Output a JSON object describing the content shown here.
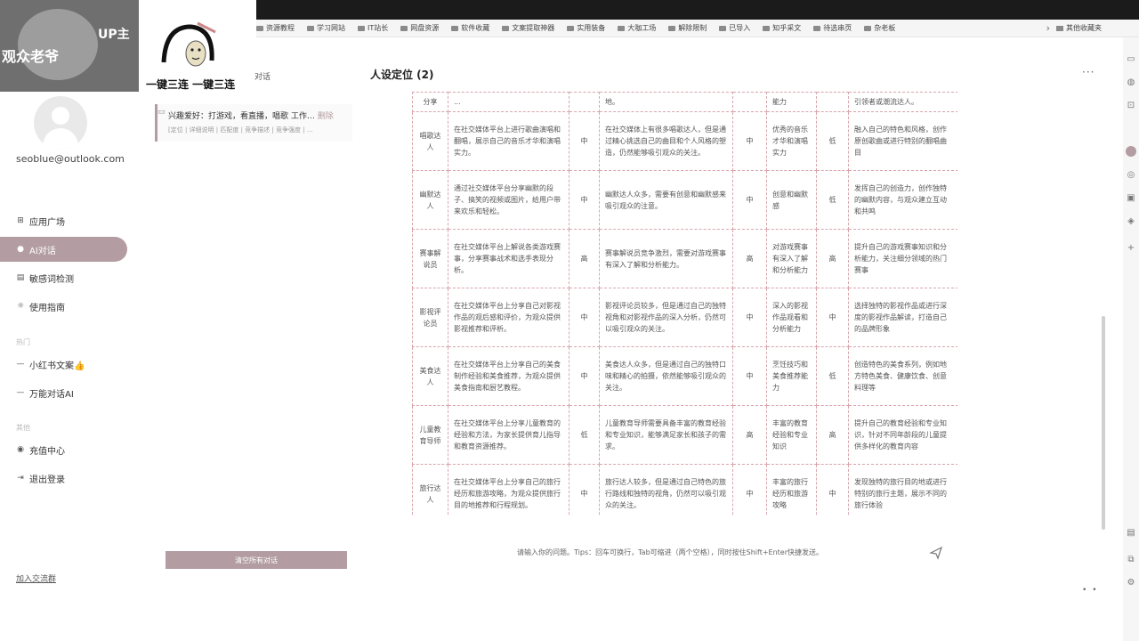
{
  "browser": {
    "bookmarks": [
      "资源教程",
      "学习网站",
      "IT站长",
      "网盘资源",
      "软件收藏",
      "文案提取神器",
      "实用装备",
      "大咖工场",
      "解除限制",
      "已导入",
      "知乎采文",
      "待选串页",
      "杂老板"
    ],
    "other_bookmarks": "其他收藏夹"
  },
  "overlay": {
    "channel_text": "观众老爷",
    "up_text": "UP主",
    "meme_caption": "一键三连 一键三连"
  },
  "sidebar": {
    "email": "seoblue@outlook.com",
    "nav": [
      {
        "label": "应用广场",
        "icon": "grid-icon"
      },
      {
        "label": "AI对话",
        "icon": "chat-icon"
      },
      {
        "label": "敏感词检测",
        "icon": "document-icon"
      },
      {
        "label": "使用指南",
        "icon": "sun-icon"
      }
    ],
    "section1": "热门",
    "apps": [
      {
        "label": "小红书文案👍",
        "icon": "dash-icon"
      },
      {
        "label": "万能对话AI",
        "icon": "dash-icon"
      }
    ],
    "section2": "其他",
    "account": [
      {
        "label": "充值中心",
        "icon": "wallet-icon"
      },
      {
        "label": "退出登录",
        "icon": "logout-icon"
      }
    ],
    "join_link": "加入交流群"
  },
  "history": {
    "header": "对话",
    "item_title": "兴趣爱好：打游戏，看直播，唱歌 工作…",
    "item_badge": "删除",
    "item_tags": "[定位 | 详细说明 | 匹配度 | 竞争描述 | 竞争强度 | …",
    "clear_button": "清空所有对话"
  },
  "main": {
    "title": "人设定位 (2)",
    "more": "···",
    "partial_row": {
      "c1": "分享",
      "c2": "...",
      "c3": "",
      "c4": "地。",
      "c5": "",
      "c6": "能力",
      "c7": "",
      "c8": "引领者或潮流达人。"
    },
    "rows": [
      {
        "c1": "唱歌达人",
        "c2": "在社交媒体平台上进行歌曲演唱和翻唱，展示自己的音乐才华和演唱实力。",
        "c3": "中",
        "c4": "在社交媒体上有很多唱歌达人，但是通过精心挑选自己的曲目和个人风格的塑造，仍然能够吸引观众的关注。",
        "c5": "中",
        "c6": "优秀的音乐才华和演唱实力",
        "c7": "低",
        "c8": "融入自己的特色和风格，创作原创歌曲或进行特别的翻唱曲目"
      },
      {
        "c1": "幽默达人",
        "c2": "通过社交媒体平台分享幽默的段子、搞笑的视频或图片，给用户带来欢乐和轻松。",
        "c3": "中",
        "c4": "幽默达人众多，需要有创意和幽默感来吸引观众的注意。",
        "c5": "中",
        "c6": "创意和幽默感",
        "c7": "低",
        "c8": "发挥自己的创造力，创作独特的幽默内容，与观众建立互动和共鸣"
      },
      {
        "c1": "赛事解说员",
        "c2": "在社交媒体平台上解说各类游戏赛事，分享赛事战术和选手表现分析。",
        "c3": "高",
        "c4": "赛事解说员竞争激烈，需要对游戏赛事有深入了解和分析能力。",
        "c5": "高",
        "c6": "对游戏赛事有深入了解和分析能力",
        "c7": "高",
        "c8": "提升自己的游戏赛事知识和分析能力，关注细分领域的热门赛事"
      },
      {
        "c1": "影视评论员",
        "c2": "在社交媒体平台上分享自己对影视作品的观后感和评价，为观众提供影视推荐和评析。",
        "c3": "中",
        "c4": "影视评论员较多，但是通过自己的独特视角和对影视作品的深入分析，仍然可以吸引观众的关注。",
        "c5": "中",
        "c6": "深入的影视作品观看和分析能力",
        "c7": "中",
        "c8": "选择独特的影视作品或进行深度的影视作品解读，打造自己的品牌形象"
      },
      {
        "c1": "美食达人",
        "c2": "在社交媒体平台上分享自己的美食制作经验和美食推荐，为观众提供美食指南和厨艺教程。",
        "c3": "中",
        "c4": "美食达人众多，但是通过自己的独特口味和精心的拍摄，依然能够吸引观众的关注。",
        "c5": "中",
        "c6": "烹饪技巧和美食推荐能力",
        "c7": "低",
        "c8": "创造特色的美食系列，例如地方特色美食、健康饮食、创意料理等"
      },
      {
        "c1": "儿童教育导师",
        "c2": "在社交媒体平台上分享儿童教育的经验和方法，为家长提供育儿指导和教育资源推荐。",
        "c3": "低",
        "c4": "儿童教育导师需要具备丰富的教育经验和专业知识，能够满足家长和孩子的需求。",
        "c5": "高",
        "c6": "丰富的教育经验和专业知识",
        "c7": "高",
        "c8": "提升自己的教育经验和专业知识，针对不同年龄段的儿童提供多样化的教育内容"
      },
      {
        "c1": "旅行达人",
        "c2": "在社交媒体平台上分享自己的旅行经历和旅游攻略，为观众提供旅行目的地推荐和行程规划。",
        "c3": "中",
        "c4": "旅行达人较多，但是通过自己特色的旅行路线和独特的视角，仍然可以吸引观众的关注。",
        "c5": "中",
        "c6": "丰富的旅行经历和旅游攻略",
        "c7": "中",
        "c8": "发现独特的旅行目的地或进行特别的旅行主题，展示不同的旅行体验"
      }
    ],
    "input_placeholder": "请输入你的问题。Tips：回车可换行，Tab可缩进（两个空格），同时按住Shift+Enter快捷发送。"
  },
  "colors": {
    "accent": "#b39da2",
    "border": "#d9a5ad"
  }
}
